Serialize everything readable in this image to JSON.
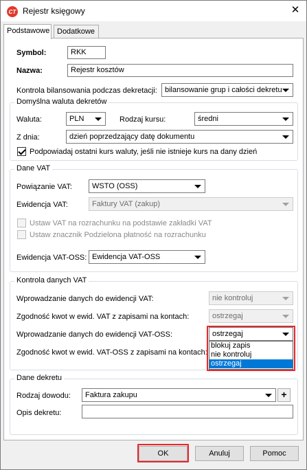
{
  "window": {
    "title": "Rejestr księgowy",
    "icon_text": "CT",
    "close_glyph": "✕"
  },
  "tabs": [
    {
      "label": "Podstawowe",
      "active": true
    },
    {
      "label": "Dodatkowe",
      "active": false
    }
  ],
  "symbol": {
    "label": "Symbol:",
    "value": "RKK"
  },
  "nazwa": {
    "label": "Nazwa:",
    "value": "Rejestr kosztów"
  },
  "kontrola_bilansowania": {
    "label": "Kontrola bilansowania podczas dekretacji:",
    "value": "bilansowanie grup i całości dekretu"
  },
  "waluta_group": {
    "title": "Domyślna waluta dekretów",
    "waluta": {
      "label": "Waluta:",
      "value": "PLN"
    },
    "rodzaj_kursu": {
      "label": "Rodzaj kursu:",
      "value": "średni"
    },
    "z_dnia": {
      "label": "Z dnia:",
      "value": "dzień poprzedzający datę dokumentu"
    },
    "podpowiadaj": {
      "label": "Podpowiadaj ostatni kurs waluty, jeśli nie istnieje kurs na dany dzień",
      "checked": true
    }
  },
  "vat_group": {
    "title": "Dane VAT",
    "powiazanie": {
      "label": "Powiązanie VAT:",
      "value": "WSTO (OSS)"
    },
    "ewidencja": {
      "label": "Ewidencja VAT:",
      "value": "Faktury VAT (zakup)"
    },
    "ustaw_vat": {
      "label": "Ustaw VAT na rozrachunku na podstawie zakładki VAT",
      "checked": false
    },
    "ustaw_znacznik": {
      "label": "Ustaw znacznik Podzielona płatność na rozrachunku",
      "checked": false
    },
    "ewidencja_oss": {
      "label": "Ewidencja VAT-OSS:",
      "value": "Ewidencja VAT-OSS"
    }
  },
  "kontrola_group": {
    "title": "Kontrola danych VAT",
    "wprowadzanie_vat": {
      "label": "Wprowadzanie danych do ewidencji VAT:",
      "value": "nie kontroluj"
    },
    "zgodnosc_vat": {
      "label": "Zgodność kwot w ewid. VAT z zapisami na kontach:",
      "value": "ostrzegaj"
    },
    "wprowadzanie_oss": {
      "label": "Wprowadzanie danych do ewidencji VAT-OSS:",
      "value": "ostrzegaj"
    },
    "zgodnosc_oss": {
      "label": "Zgodność kwot w ewid. VAT-OSS z zapisami na kontach:"
    },
    "dropdown_options": [
      {
        "label": "blokuj zapis",
        "selected": false
      },
      {
        "label": "nie kontroluj",
        "selected": false
      },
      {
        "label": "ostrzegaj",
        "selected": true
      }
    ]
  },
  "dekret_group": {
    "title": "Dane dekretu",
    "rodzaj_dowodu": {
      "label": "Rodzaj dowodu:",
      "value": "Faktura zakupu"
    },
    "add_glyph": "+",
    "opis": {
      "label": "Opis dekretu:",
      "value": ""
    }
  },
  "footer": {
    "ok": "OK",
    "anuluj": "Anuluj",
    "pomoc": "Pomoc"
  },
  "colors": {
    "highlight": "#e8262a",
    "selection": "#0078d7"
  }
}
